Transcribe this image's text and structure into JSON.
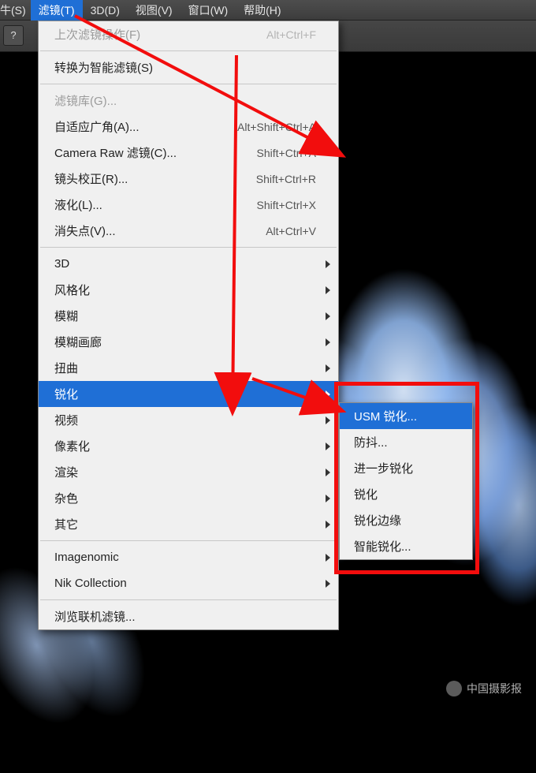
{
  "menubar": {
    "partial": "牛(S)",
    "items": [
      "滤镜(T)",
      "3D(D)",
      "视图(V)",
      "窗口(W)",
      "帮助(H)"
    ],
    "active_index": 0
  },
  "toolbar": {
    "search_icon_label": "?"
  },
  "dropdown": {
    "last_filter": {
      "label": "上次滤镜操作(F)",
      "shortcut": "Alt+Ctrl+F",
      "disabled": true
    },
    "convert_smart": {
      "label": "转换为智能滤镜(S)"
    },
    "filter_gallery": {
      "label": "滤镜库(G)...",
      "disabled": true
    },
    "adaptive_wide": {
      "label": "自适应广角(A)...",
      "shortcut": "Alt+Shift+Ctrl+A"
    },
    "camera_raw": {
      "label": "Camera Raw 滤镜(C)...",
      "shortcut": "Shift+Ctrl+A"
    },
    "lens_correction": {
      "label": "镜头校正(R)...",
      "shortcut": "Shift+Ctrl+R"
    },
    "liquify": {
      "label": "液化(L)...",
      "shortcut": "Shift+Ctrl+X"
    },
    "vanishing": {
      "label": "消失点(V)...",
      "shortcut": "Alt+Ctrl+V"
    },
    "group_submenus": [
      "3D",
      "风格化",
      "模糊",
      "模糊画廊",
      "扭曲",
      "锐化",
      "视频",
      "像素化",
      "渲染",
      "杂色",
      "其它"
    ],
    "highlight_index": 5,
    "plugins": [
      "Imagenomic",
      "Nik Collection"
    ],
    "browse": {
      "label": "浏览联机滤镜..."
    }
  },
  "submenu": {
    "items": [
      "USM 锐化...",
      "防抖...",
      "进一步锐化",
      "锐化",
      "锐化边缘",
      "智能锐化..."
    ],
    "highlight_index": 0
  },
  "watermark": {
    "text": "中国摄影报"
  },
  "annotation": {
    "color": "#f20d0d"
  }
}
